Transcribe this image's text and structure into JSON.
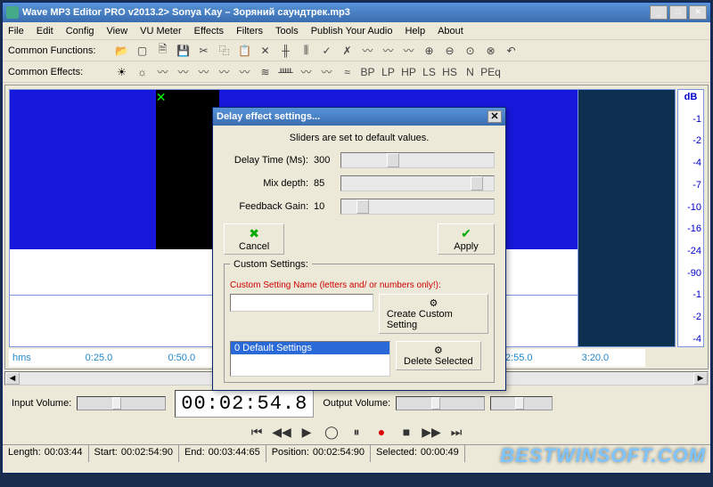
{
  "window": {
    "title": "Wave MP3 Editor PRO v2013.2> Sonya Kay – Зоряний саундтрек.mp3"
  },
  "menu": [
    "File",
    "Edit",
    "Config",
    "View",
    "VU Meter",
    "Effects",
    "Filters",
    "Tools",
    "Publish Your Audio",
    "Help",
    "About"
  ],
  "toolbar1_label": "Common Functions:",
  "toolbar2_label": "Common Effects:",
  "filterbar": [
    "BP",
    "LP",
    "HP",
    "LS",
    "HS",
    "N",
    "PEq"
  ],
  "db_header": "dB",
  "db_ticks": [
    "-1",
    "-2",
    "-4",
    "-7",
    "-10",
    "-16",
    "-24",
    "-90",
    "-1",
    "-2",
    "-4"
  ],
  "timeline_label": "hms",
  "timeline_ticks": [
    "0:25.0",
    "0:50.0",
    "2:55.0",
    "3:20.0"
  ],
  "input_vol_label": "Input Volume:",
  "output_vol_label": "Output Volume:",
  "timer": "00:02:54.8",
  "status": {
    "length_label": "Length:",
    "length_val": "00:03:44",
    "start_label": "Start:",
    "start_val": "00:02:54:90",
    "end_label": "End:",
    "end_val": "00:03:44:65",
    "position_label": "Position:",
    "position_val": "00:02:54:90",
    "selected_label": "Selected:",
    "selected_val": "00:00:49"
  },
  "dialog": {
    "title": "Delay effect settings...",
    "message": "Sliders are set to default values.",
    "params": [
      {
        "label": "Delay Time (Ms):",
        "value": "300",
        "pos": 30
      },
      {
        "label": "Mix depth:",
        "value": "85",
        "pos": 85
      },
      {
        "label": "Feedback Gain:",
        "value": "10",
        "pos": 10
      }
    ],
    "cancel": "Cancel",
    "apply": "Apply",
    "custom_section": "Custom Settings:",
    "custom_label": "Custom Setting Name (letters and/ or numbers only!):",
    "create_btn": "Create Custom Setting",
    "list_item": "0 Default Settings",
    "delete_btn": "Delete Selected"
  },
  "watermark": "BESTWINSOFT.COM"
}
